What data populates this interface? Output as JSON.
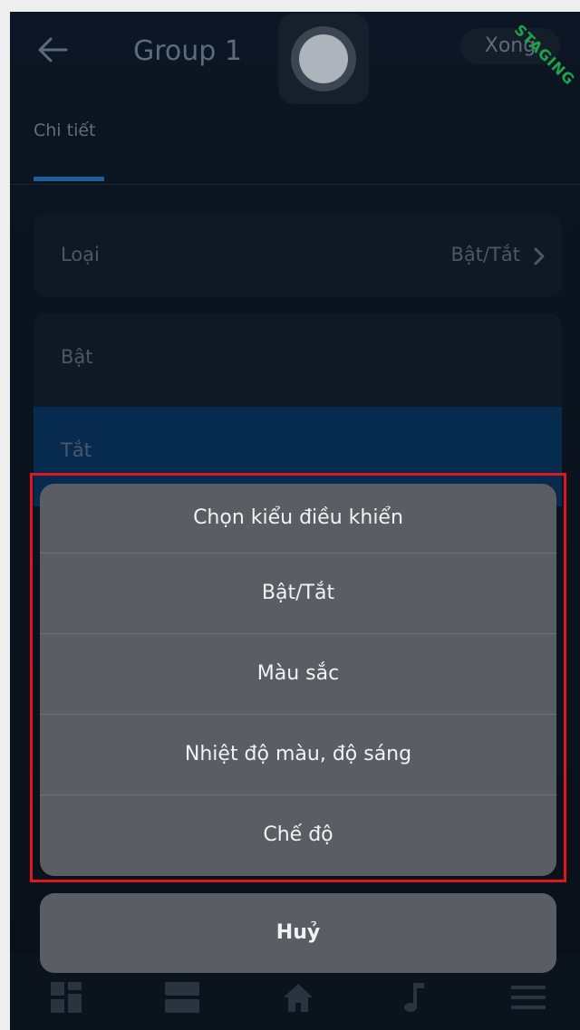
{
  "header": {
    "title": "Group 1",
    "done_label": "Xong",
    "env_badge": "STAGING"
  },
  "tabs": [
    {
      "label": "Chi tiết",
      "active": true
    }
  ],
  "settings": {
    "type_label": "Loại",
    "type_value": "Bật/Tắt",
    "on_label": "Bật",
    "off_label": "Tắt"
  },
  "action_sheet": {
    "title": "Chọn kiểu điều khiển",
    "options": [
      "Bật/Tắt",
      "Màu sắc",
      "Nhiệt độ màu, độ sáng",
      "Chế độ"
    ],
    "cancel_label": "Huỷ"
  },
  "bottom_nav": {
    "icons": [
      "dashboard-icon",
      "rooms-icon",
      "home-icon",
      "music-icon",
      "menu-icon"
    ]
  },
  "colors": {
    "highlight": "#e0161e",
    "sheet_bg": "#5a5d64",
    "tab_indicator": "#1d5f9a",
    "selected_row": "#062b4f",
    "staging_badge": "#21a34a"
  }
}
